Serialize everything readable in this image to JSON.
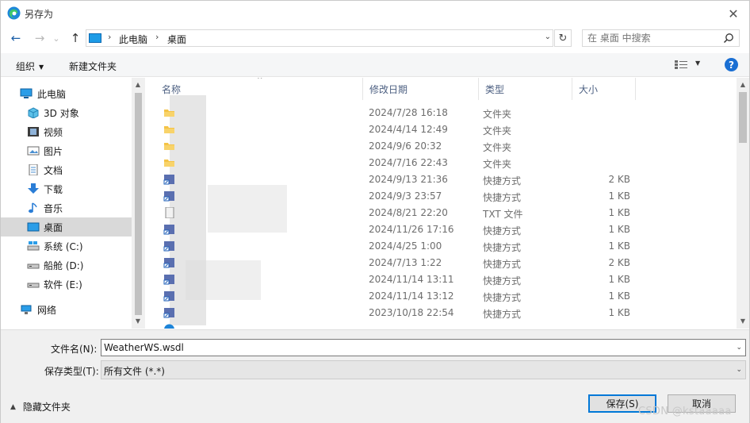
{
  "window": {
    "title": "另存为",
    "close_glyph": "✕"
  },
  "address": {
    "back_glyph": "←",
    "forward_glyph": "→",
    "recent_glyph": "⌄",
    "up_glyph": "↑",
    "crumbs": [
      "此电脑",
      "桌面"
    ],
    "sep_glyph": "›",
    "dropdown_glyph": "⌄",
    "refresh_glyph": "↻",
    "search_placeholder": "在 桌面 中搜索"
  },
  "toolbar": {
    "organize_label": "组织",
    "new_folder_label": "新建文件夹",
    "caret_glyph": "▼",
    "help_glyph": "?"
  },
  "nav": {
    "items": [
      {
        "label": "此电脑",
        "icon": "pc-icon"
      },
      {
        "label": "3D 对象",
        "icon": "cube-icon"
      },
      {
        "label": "视频",
        "icon": "video-icon"
      },
      {
        "label": "图片",
        "icon": "picture-icon"
      },
      {
        "label": "文档",
        "icon": "document-icon"
      },
      {
        "label": "下载",
        "icon": "download-icon"
      },
      {
        "label": "音乐",
        "icon": "music-icon"
      },
      {
        "label": "桌面",
        "icon": "desktop-icon"
      },
      {
        "label": "系统 (C:)",
        "icon": "drive-c-icon"
      },
      {
        "label": "船舱 (D:)",
        "icon": "drive-icon"
      },
      {
        "label": "软件 (E:)",
        "icon": "drive-icon"
      },
      {
        "label": "网络",
        "icon": "network-icon"
      }
    ],
    "up_arrow": "▲",
    "down_arrow": "▼"
  },
  "columns": {
    "name": "名称",
    "modified": "修改日期",
    "type": "类型",
    "size": "大小",
    "sort_glyph": "^"
  },
  "files": [
    {
      "date": "2024/7/28 16:18",
      "type": "文件夹",
      "size": "",
      "icon": "folder-icon"
    },
    {
      "date": "2024/4/14 12:49",
      "type": "文件夹",
      "size": "",
      "icon": "folder-icon"
    },
    {
      "date": "2024/9/6 20:32",
      "type": "文件夹",
      "size": "",
      "icon": "folder-icon"
    },
    {
      "date": "2024/7/16 22:43",
      "type": "文件夹",
      "size": "",
      "icon": "folder-icon"
    },
    {
      "date": "2024/9/13 21:36",
      "type": "快捷方式",
      "size": "2 KB",
      "icon": "shortcut-icon"
    },
    {
      "date": "2024/9/3 23:57",
      "type": "快捷方式",
      "size": "1 KB",
      "icon": "shortcut-icon"
    },
    {
      "date": "2024/8/21 22:20",
      "type": "TXT 文件",
      "size": "1 KB",
      "icon": "text-file-icon"
    },
    {
      "date": "2024/11/26 17:16",
      "type": "快捷方式",
      "size": "1 KB",
      "icon": "shortcut-icon"
    },
    {
      "date": "2024/4/25 1:00",
      "type": "快捷方式",
      "size": "1 KB",
      "icon": "shortcut-icon"
    },
    {
      "date": "2024/7/13 1:22",
      "type": "快捷方式",
      "size": "2 KB",
      "icon": "shortcut-icon"
    },
    {
      "date": "2024/11/14 13:11",
      "type": "快捷方式",
      "size": "1 KB",
      "icon": "shortcut-icon"
    },
    {
      "date": "2024/11/14 13:12",
      "type": "快捷方式",
      "size": "1 KB",
      "icon": "shortcut-icon"
    },
    {
      "date": "2023/10/18 22:54",
      "type": "快捷方式",
      "size": "1 KB",
      "icon": "shortcut-icon"
    }
  ],
  "form": {
    "filename_label": "文件名(N):",
    "filename_value": "WeatherWS.wsdl",
    "filetype_label": "保存类型(T):",
    "filetype_value": "所有文件 (*.*)",
    "hide_folders_label": "隐藏文件夹",
    "hide_glyph": "▲",
    "save_label": "保存(S)",
    "cancel_label": "取消",
    "dropdown_glyph": "⌄"
  },
  "watermark": "CSDN @kstaaaaa",
  "colors": {
    "accent": "#0078d7",
    "selected_bg": "#d9d9d9",
    "header_text": "#4d6082",
    "folder": "#f4c346",
    "help": "#1a6fd3"
  }
}
